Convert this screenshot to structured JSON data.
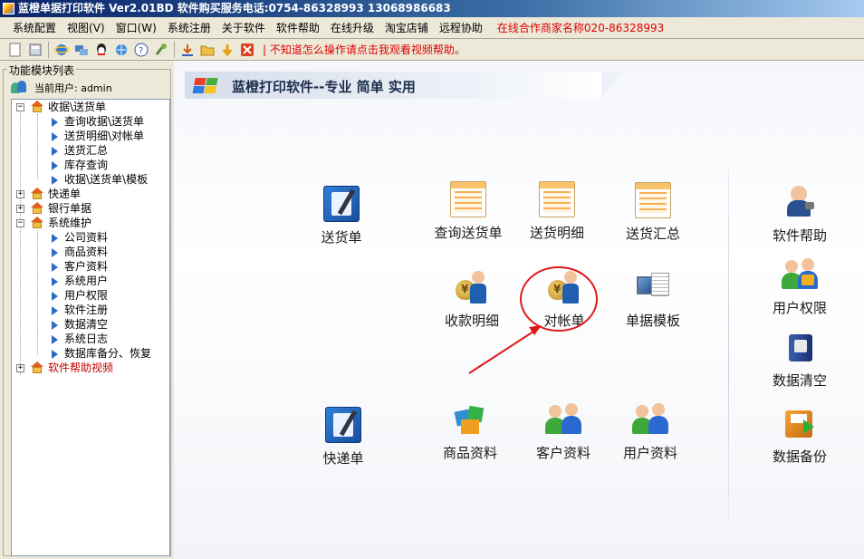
{
  "window": {
    "title": "蓝橙单据打印软件 Ver2.01BD  软件购买服务电话:0754-86328993 13068986683"
  },
  "menubar": {
    "items": [
      "系统配置",
      "视图(V)",
      "窗口(W)",
      "系统注册",
      "关于软件",
      "软件帮助",
      "在线升级",
      "淘宝店铺",
      "远程协助"
    ],
    "notice": "在线合作商家名称020-86328993",
    "notice_color": "#e00000"
  },
  "toolbar": {
    "icons": [
      "new-icon",
      "calculator-icon",
      "ie-icon",
      "network-icon",
      "qq-icon",
      "browser-icon",
      "help-icon",
      "tools-icon",
      "download-icon",
      "folder-icon",
      "arrow-icon",
      "close-icon"
    ],
    "notice": "| 不知道怎么操作请点击我观看视频帮助。"
  },
  "left_panel": {
    "title": "功能模块列表",
    "current_user_label": "当前用户: admin",
    "tree": [
      {
        "type": "group",
        "label": "收据\\送货单",
        "expanded": true
      },
      {
        "type": "leaf",
        "label": "查询收据\\送货单"
      },
      {
        "type": "leaf",
        "label": "送货明细\\对帐单"
      },
      {
        "type": "leaf",
        "label": "送货汇总"
      },
      {
        "type": "leaf",
        "label": "库存查询"
      },
      {
        "type": "leaf",
        "label": "收据\\送货单\\模板"
      },
      {
        "type": "group",
        "label": "快递单",
        "expanded": false
      },
      {
        "type": "group",
        "label": "银行单据",
        "expanded": false
      },
      {
        "type": "group",
        "label": "系统维护",
        "expanded": true
      },
      {
        "type": "leaf",
        "label": "公司资料"
      },
      {
        "type": "leaf",
        "label": "商品资料"
      },
      {
        "type": "leaf",
        "label": "客户资料"
      },
      {
        "type": "leaf",
        "label": "系统用户"
      },
      {
        "type": "leaf",
        "label": "用户权限"
      },
      {
        "type": "leaf",
        "label": "软件注册"
      },
      {
        "type": "leaf",
        "label": "数据清空"
      },
      {
        "type": "leaf",
        "label": "系统日志"
      },
      {
        "type": "leaf",
        "label": "数据库备分、恢复"
      },
      {
        "type": "group",
        "label": "软件帮助视频",
        "expanded": false,
        "special": true
      }
    ]
  },
  "main": {
    "banner_text": "蓝橙打印软件--专业 简单 实用",
    "modules": {
      "delivery": "送货单",
      "query_delivery": "查询送货单",
      "delivery_detail": "送货明细",
      "delivery_summary": "送货汇总",
      "receipt_detail": "收款明细",
      "statement": "对帐单",
      "doc_template": "单据模板",
      "express": "快递单",
      "goods_info": "商品资料",
      "customer_info": "客户资料",
      "user_info": "用户资料",
      "software_help": "软件帮助",
      "user_permission": "用户权限",
      "data_clear": "数据清空",
      "data_backup": "数据备份"
    },
    "annotation_color": "#e01818"
  }
}
